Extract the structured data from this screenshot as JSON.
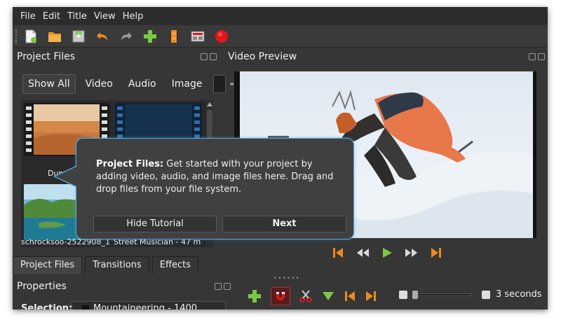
{
  "menu": [
    "File",
    "Edit",
    "Title",
    "View",
    "Help"
  ],
  "toolbar": {
    "icons": [
      "new-project-icon",
      "open-project-icon",
      "save-project-icon",
      "undo-icon",
      "redo-icon",
      "import-files-icon",
      "choose-profile-icon",
      "fullscreen-icon",
      "export-video-icon"
    ]
  },
  "project_files": {
    "title": "Project Files",
    "filters": [
      "Show All",
      "Video",
      "Audio",
      "Image"
    ],
    "files": [
      {
        "label": "Dun"
      },
      {
        "label": ""
      },
      {
        "label": ""
      }
    ],
    "partial_labels": [
      "schrocksoo-2522908_1",
      "Street Musician - 47 m"
    ]
  },
  "bottom_tabs": [
    "Project Files",
    "Transitions",
    "Effects"
  ],
  "properties": {
    "title": "Properties",
    "selection_label": "Selection:",
    "selection_value": "Mountaineering - 1400"
  },
  "video_preview": {
    "title": "Video Preview"
  },
  "tutorial": {
    "heading": "Project Files:",
    "body": " Get started with your project by adding video, audio, and image files here. Drag and drop files from your file system.",
    "hide_label": "Hide Tutorial",
    "next_label": "Next"
  },
  "timeline": {
    "zoom_label": "3 seconds"
  },
  "colors": {
    "accent_orange": "#ef8a1e",
    "play_green": "#7ac943",
    "record_red": "#e0161a",
    "tutorial_border": "#5aaae0"
  }
}
